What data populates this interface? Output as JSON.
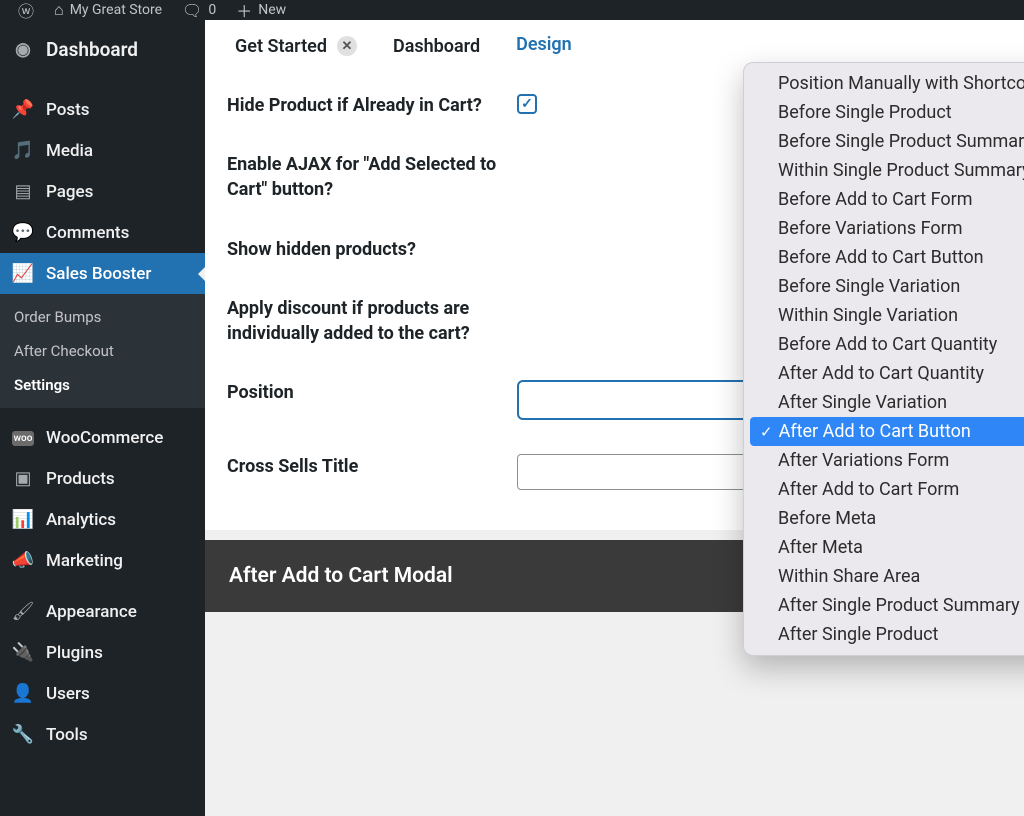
{
  "adminBar": {
    "siteName": "My Great Store",
    "commentCount": "0",
    "newLabel": "New"
  },
  "sidebar": {
    "dashboard": "Dashboard",
    "posts": "Posts",
    "media": "Media",
    "pages": "Pages",
    "comments": "Comments",
    "salesBooster": "Sales Booster",
    "submenu": {
      "orderBumps": "Order Bumps",
      "afterCheckout": "After Checkout",
      "settings": "Settings"
    },
    "woocommerce": "WooCommerce",
    "products": "Products",
    "analytics": "Analytics",
    "marketing": "Marketing",
    "appearance": "Appearance",
    "plugins": "Plugins",
    "users": "Users",
    "tools": "Tools"
  },
  "tabs": {
    "getStarted": "Get Started",
    "dashboard": "Dashboard",
    "design": "Design"
  },
  "form": {
    "hideProduct": "Hide Product if Already in Cart?",
    "enableAjax": "Enable AJAX for \"Add Selected to Cart\" button?",
    "showHidden": "Show hidden products?",
    "applyDiscount": "Apply discount if products are individually added to the cart?",
    "position": "Position",
    "crossSellsTitle": "Cross Sells Title"
  },
  "dropdown": {
    "options": [
      "Position Manually with Shortcode",
      "Before Single Product",
      "Before Single Product Summary",
      "Within Single Product Summary",
      "Before Add to Cart Form",
      "Before Variations Form",
      "Before Add to Cart Button",
      "Before Single Variation",
      "Within Single Variation",
      "Before Add to Cart Quantity",
      "After Add to Cart Quantity",
      "After Single Variation",
      "After Add to Cart Button",
      "After Variations Form",
      "After Add to Cart Form",
      "Before Meta",
      "After Meta",
      "Within Share Area",
      "After Single Product Summary",
      "After Single Product"
    ],
    "selectedIndex": 12
  },
  "panel": {
    "afterModal": "After Add to Cart Modal"
  }
}
